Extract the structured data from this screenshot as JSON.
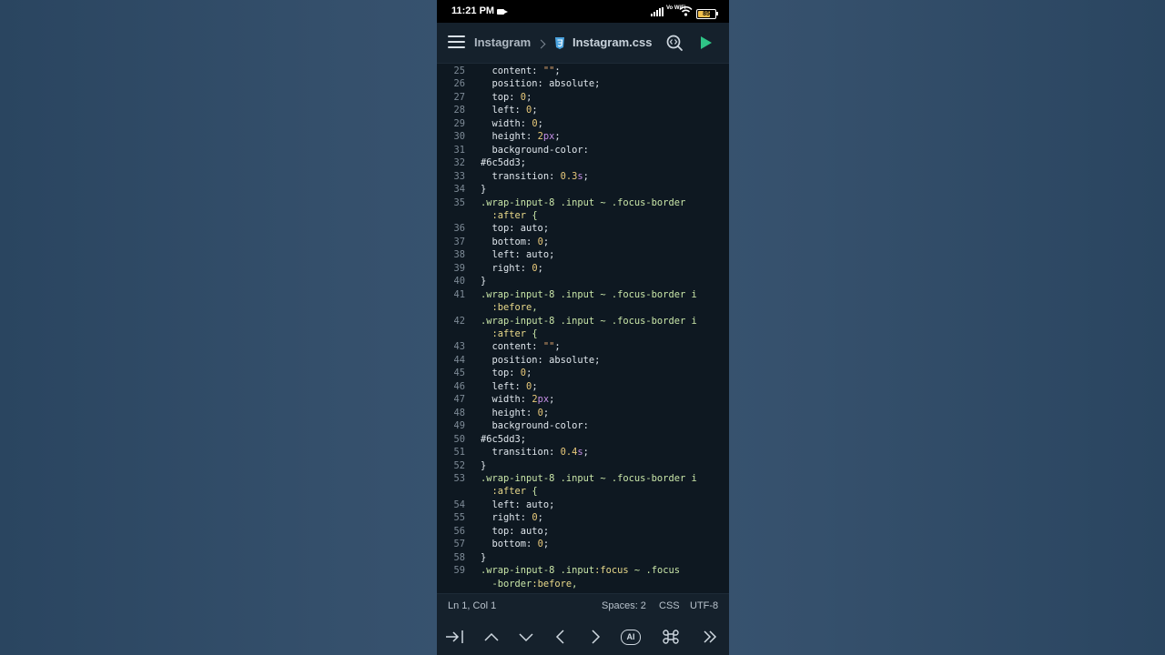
{
  "status_bar": {
    "time": "11:21 PM",
    "network": "Vo WiFi",
    "battery": "85"
  },
  "toolbar": {
    "folder": "Instagram",
    "file": "Instagram.css"
  },
  "editor": {
    "lines": [
      {
        "n": "25",
        "text": "  content: \"\";"
      },
      {
        "n": "26",
        "text": "  position: absolute;"
      },
      {
        "n": "27",
        "text": "  top: 0;"
      },
      {
        "n": "28",
        "text": "  left: 0;"
      },
      {
        "n": "29",
        "text": "  width: 0;"
      },
      {
        "n": "30",
        "text": "  height: 2px;"
      },
      {
        "n": "31",
        "text": "  background-color:"
      },
      {
        "n": "32",
        "text": "#6c5dd3;"
      },
      {
        "n": "33",
        "text": "  transition: 0.3s;"
      },
      {
        "n": "34",
        "text": "}"
      },
      {
        "n": "35",
        "text": ".wrap-input-8 .input ~ .focus-border"
      },
      {
        "n": "",
        "text": "  :after {"
      },
      {
        "n": "36",
        "text": "  top: auto;"
      },
      {
        "n": "37",
        "text": "  bottom: 0;"
      },
      {
        "n": "38",
        "text": "  left: auto;"
      },
      {
        "n": "39",
        "text": "  right: 0;"
      },
      {
        "n": "40",
        "text": "}"
      },
      {
        "n": "41",
        "text": ".wrap-input-8 .input ~ .focus-border i"
      },
      {
        "n": "",
        "text": "  :before,"
      },
      {
        "n": "42",
        "text": ".wrap-input-8 .input ~ .focus-border i"
      },
      {
        "n": "",
        "text": "  :after {"
      },
      {
        "n": "43",
        "text": "  content: \"\";"
      },
      {
        "n": "44",
        "text": "  position: absolute;"
      },
      {
        "n": "45",
        "text": "  top: 0;"
      },
      {
        "n": "46",
        "text": "  left: 0;"
      },
      {
        "n": "47",
        "text": "  width: 2px;"
      },
      {
        "n": "48",
        "text": "  height: 0;"
      },
      {
        "n": "49",
        "text": "  background-color:"
      },
      {
        "n": "50",
        "text": "#6c5dd3;"
      },
      {
        "n": "51",
        "text": "  transition: 0.4s;"
      },
      {
        "n": "52",
        "text": "}"
      },
      {
        "n": "53",
        "text": ".wrap-input-8 .input ~ .focus-border i"
      },
      {
        "n": "",
        "text": "  :after {"
      },
      {
        "n": "54",
        "text": "  left: auto;"
      },
      {
        "n": "55",
        "text": "  right: 0;"
      },
      {
        "n": "56",
        "text": "  top: auto;"
      },
      {
        "n": "57",
        "text": "  bottom: 0;"
      },
      {
        "n": "58",
        "text": "}"
      },
      {
        "n": "59",
        "text": ".wrap-input-8 .input:focus ~ .focus"
      },
      {
        "n": "",
        "text": "  -border:before,"
      }
    ]
  },
  "status_line": {
    "cursor": "Ln 1, Col 1",
    "spaces": "Spaces: 2",
    "language": "CSS",
    "encoding": "UTF-8"
  },
  "key_bar": {
    "ai_label": "AI"
  },
  "colors": {
    "editor_bg": "#0e1821",
    "toolbar_bg": "#15212c",
    "run_green": "#2fc386",
    "css_blue": "#4aa3df",
    "selector": "#c9e6a8",
    "number": "#c58fe6"
  }
}
